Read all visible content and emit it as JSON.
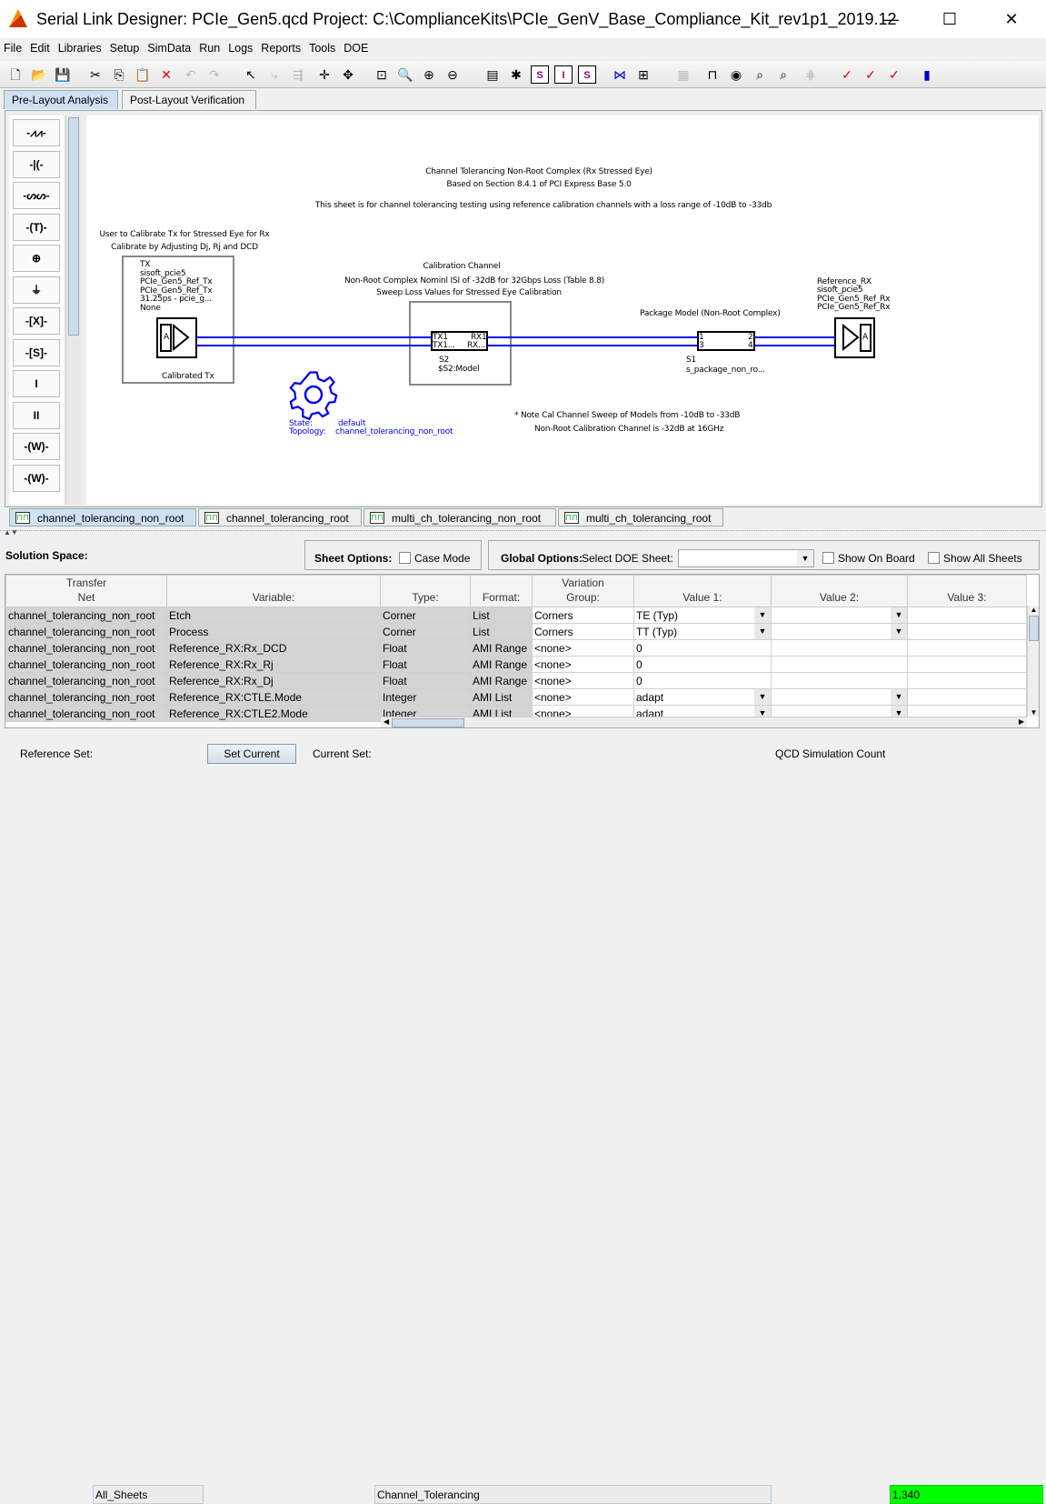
{
  "window": {
    "title": "Serial Link Designer: PCIe_Gen5.qcd Project: C:\\ComplianceKits\\PCIe_GenV_Base_Compliance_Kit_rev1p1_2019.12",
    "minimize": "—",
    "maximize": "☐",
    "close": "✕"
  },
  "menu": [
    "File",
    "Edit",
    "Libraries",
    "Setup",
    "SimData",
    "Run",
    "Logs",
    "Reports",
    "Tools",
    "DOE"
  ],
  "toolbar_icons": [
    "new-icon",
    "open-icon",
    "save-icon",
    "cut-icon",
    "copy-icon",
    "paste-icon",
    "delete-icon",
    "undo-icon",
    "redo-icon",
    "pointer-icon",
    "route-icon",
    "connect-icon",
    "crosshair-icon",
    "move-icon",
    "zoom-fit-icon",
    "zoom-icon",
    "zoom-in-icon",
    "zoom-out-icon",
    "library-icon",
    "tool-icon",
    "report-s-icon",
    "report-i-icon",
    "report-s2-icon",
    "net-icon",
    "wave-icon",
    "comment-icon",
    "waveform-icon",
    "eye-icon",
    "inspect-icon",
    "inspect-s-icon",
    "bus-icon",
    "check-icon",
    "check-inspect-icon",
    "check-inspect2-icon",
    "book-icon"
  ],
  "main_tabs": [
    {
      "label": "Pre-Layout Analysis",
      "selected": true
    },
    {
      "label": "Post-Layout Verification",
      "selected": false
    }
  ],
  "palette": [
    "resistor-icon",
    "capacitor-icon",
    "inductor-icon",
    "transmission-line-icon",
    "source-icon",
    "ground-icon",
    "x-block-icon",
    "s-block-icon",
    "via-icon",
    "multi-via-icon",
    "w-element-icon",
    "w-element2-icon"
  ],
  "schematic": {
    "header": [
      "Channel Tolerancing Non-Root Complex (Rx Stressed Eye)",
      "Based on Section 8.4.1 of PCI Express Base 5.0",
      "This sheet is for channel tolerancing testing using reference calibration channels with a loss range of -10dB to -33db"
    ],
    "tx_note": [
      "User to Calibrate Tx for Stressed Eye for Rx",
      "Calibrate by Adjusting Dj, Rj and DCD"
    ],
    "tx": [
      "TX",
      "sisoft_pcie5",
      "PCIe_Gen5_Ref_Tx",
      "PCIe_Gen5_Ref_Tx",
      "31.25ps - pcie_g...",
      "None"
    ],
    "tx_label": "Calibrated Tx",
    "cal": [
      "Calibration Channel",
      "Non-Root Complex Nominl ISI of -32dB for 32Gbps Loss (Table 8.8)",
      "Sweep Loss Values for Stressed Eye Calibration"
    ],
    "s2_pins": [
      "TX1",
      "RX1",
      "TX1...",
      "RX..."
    ],
    "s2": [
      "S2",
      "$S2:Model"
    ],
    "pkg_title": "Package Model (Non-Root Complex)",
    "s1_pins": [
      "1",
      "2",
      "3",
      "4"
    ],
    "s1": [
      "S1",
      "s_package_non_ro..."
    ],
    "rx": [
      "Reference_RX",
      "sisoft_pcie5",
      "PCIe_Gen5_Ref_Rx",
      "PCIe_Gen5_Ref_Rx"
    ],
    "buffer_label": "A",
    "state_label": "State:",
    "state_value": "default",
    "topology_label": "Topology:",
    "topology_value": "channel_tolerancing_non_root",
    "notes": [
      "* Note Cal Channel Sweep of Models from -10dB to -33dB",
      "Non-Root Calibration Channel is -32dB at 16GHz"
    ],
    "net_color": "#0000ee"
  },
  "sheet_tabs": [
    {
      "label": "channel_tolerancing_non_root",
      "selected": true
    },
    {
      "label": "channel_tolerancing_root"
    },
    {
      "label": "multi_ch_tolerancing_non_root"
    },
    {
      "label": "multi_ch_tolerancing_root"
    }
  ],
  "solution": {
    "title": "Solution Space:",
    "sheet_options": "Sheet Options:",
    "case_mode": "Case Mode",
    "global_options": "Global Options:",
    "select_doe": "Select DOE Sheet:",
    "doe_value": "",
    "show_on_board": "Show On Board",
    "show_all_sheets": "Show All Sheets"
  },
  "table": {
    "headers": [
      "Transfer\nNet",
      "Variable:",
      "Type:",
      "Format:",
      "Variation\nGroup:",
      "Value 1:",
      "Value 2:",
      "Value 3:"
    ],
    "rows": [
      [
        "channel_tolerancing_non_root",
        "Etch",
        "Corner",
        "List",
        "Corners",
        "TE (Typ)",
        "",
        ""
      ],
      [
        "channel_tolerancing_non_root",
        "Process",
        "Corner",
        "List",
        "Corners",
        "TT (Typ)",
        "",
        ""
      ],
      [
        "channel_tolerancing_non_root",
        "Reference_RX:Rx_DCD",
        "Float",
        "AMI Range",
        "<none>",
        "0",
        "",
        ""
      ],
      [
        "channel_tolerancing_non_root",
        "Reference_RX:Rx_Rj",
        "Float",
        "AMI Range",
        "<none>",
        "0",
        "",
        ""
      ],
      [
        "channel_tolerancing_non_root",
        "Reference_RX:Rx_Dj",
        "Float",
        "AMI Range",
        "<none>",
        "0",
        "",
        ""
      ],
      [
        "channel_tolerancing_non_root",
        "Reference_RX:CTLE.Mode",
        "Integer",
        "AMI List",
        "<none>",
        "adapt",
        "",
        ""
      ],
      [
        "channel_tolerancing_non_root",
        "Reference_RX:CTLE2.Mode",
        "Integer",
        "AMI List",
        "<none>",
        "adapt",
        "",
        ""
      ]
    ],
    "dropdown_rows": [
      0,
      1,
      5,
      6
    ]
  },
  "status": {
    "reference_set_label": "Reference Set:",
    "reference_set": "All_Sheets",
    "set_current": "Set Current",
    "current_set_label": "Current Set:",
    "current_set": "Channel_Tolerancing",
    "sim_count_label": "QCD Simulation Count",
    "sim_count": "1,340",
    "sim_count_color": "#00ff00"
  }
}
